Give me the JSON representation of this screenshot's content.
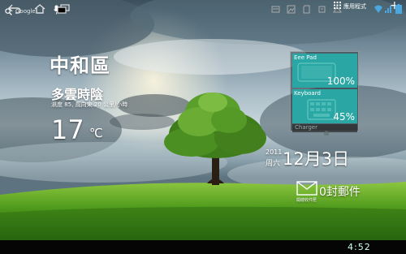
{
  "top_bar": {
    "search_label": "Google",
    "apps_label": "應用程式"
  },
  "weather": {
    "city": "中和區",
    "condition": "多雲時陰",
    "detail": "濕度 85, 風向東 20 公里/小時",
    "temperature": "17",
    "unit": "℃"
  },
  "battery": {
    "pad_name": "Eee Pad",
    "pad_percent": "100%",
    "pad_level": 1.0,
    "keyboard_name": "Keyboard",
    "keyboard_percent": "45%",
    "keyboard_level": 0.45,
    "charger_label": "Charger"
  },
  "clock_widget": {
    "year": "2011",
    "weekday": "周六",
    "date": "12月3日"
  },
  "mail": {
    "label": "開啟收件匣",
    "count_text": "0封郵件"
  },
  "navbar": {
    "time": "4:52"
  },
  "colors": {
    "battery_tile": "#2aa7a4",
    "navbar": "#050505"
  },
  "icons": [
    "search-icon",
    "microphone-icon",
    "apps-grid-icon",
    "add-icon",
    "tablet-icon",
    "keyboard-icon",
    "envelope-icon",
    "back-icon",
    "home-icon",
    "recent-apps-icon",
    "screenshot-icon",
    "gallery-icon",
    "sd-card-icon",
    "usb-icon",
    "wifi-icon",
    "battery-icon"
  ]
}
